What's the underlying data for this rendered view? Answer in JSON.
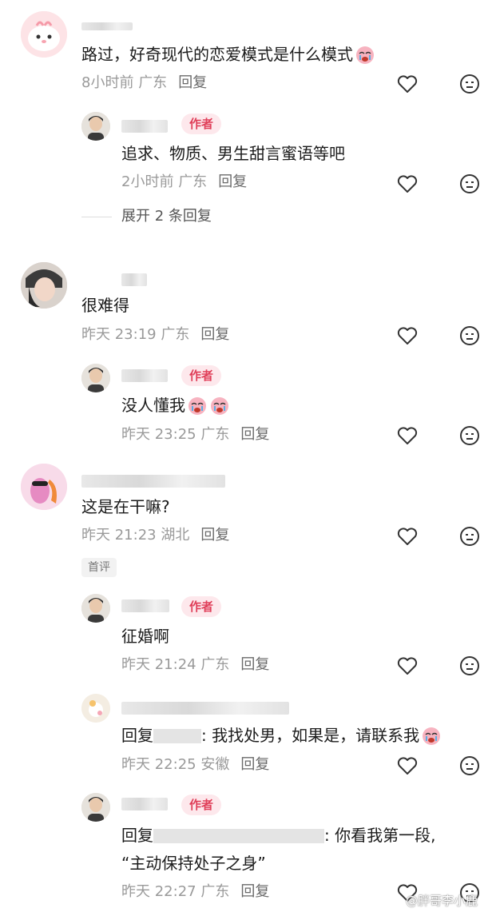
{
  "comments": [
    {
      "text": "路过，好奇现代的恋爱模式是什么模式",
      "time": "8小时前",
      "location": "广东",
      "reply_label": "回复",
      "reply": {
        "badge": "作者",
        "text": "追求、物质、男生甜言蜜语等吧",
        "time": "2小时前",
        "location": "广东",
        "reply_label": "回复"
      },
      "expand_label": "展开 2 条回复"
    },
    {
      "text": "很难得",
      "time": "昨天 23:19",
      "location": "广东",
      "reply_label": "回复",
      "reply": {
        "badge": "作者",
        "text": "没人懂我",
        "time": "昨天 23:25",
        "location": "广东",
        "reply_label": "回复"
      }
    },
    {
      "text": "这是在干嘛?",
      "time": "昨天 21:23",
      "location": "湖北",
      "reply_label": "回复",
      "first_badge": "首评",
      "replies": [
        {
          "badge": "作者",
          "text": "征婚啊",
          "time": "昨天 21:24",
          "location": "广东",
          "reply_label": "回复"
        },
        {
          "prefix": "回复",
          "text": ": 我找处男，如果是，请联系我",
          "time": "昨天 22:25",
          "location": "安徽",
          "reply_label": "回复"
        },
        {
          "badge": "作者",
          "prefix": "回复",
          "text": ": 你看我第一段,",
          "text2": "“主动保持处子之身”",
          "time": "昨天 22:27",
          "location": "广东",
          "reply_label": "回复"
        }
      ]
    }
  ],
  "watermark": "@胖哥李小鹿",
  "icons": {
    "like": "heart-icon",
    "dislike": "neutral-face-icon"
  },
  "colors": {
    "author_badge_bg": "#fde8ec",
    "author_badge_text": "#e0405a",
    "meta": "#9a9a9a"
  }
}
